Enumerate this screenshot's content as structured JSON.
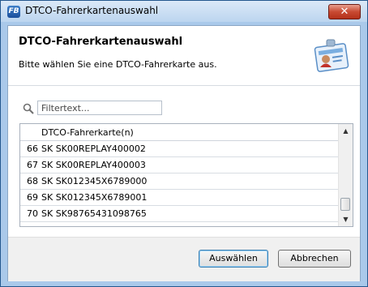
{
  "window": {
    "title": "DTCO-Fahrerkartenauswahl",
    "close_glyph": "✕",
    "app_icon_text": "FB"
  },
  "header": {
    "title": "DTCO-Fahrerkartenauswahl",
    "subtitle": "Bitte wählen Sie eine DTCO-Fahrerkarte aus.",
    "icon": "driver-card-icon"
  },
  "filter": {
    "placeholder": "Filtertext...",
    "value": "",
    "icon": "magnifier-icon"
  },
  "list": {
    "column_header": "DTCO-Fahrerkarte(n)",
    "rows": [
      {
        "num": "66",
        "value": "SK SK00REPLAY400002"
      },
      {
        "num": "67",
        "value": "SK SK00REPLAY400003"
      },
      {
        "num": "68",
        "value": "SK SK012345X6789000"
      },
      {
        "num": "69",
        "value": "SK SK012345X6789001"
      },
      {
        "num": "70",
        "value": "SK SK98765431098765"
      }
    ],
    "scroll_up": "▲",
    "scroll_down": "▼"
  },
  "buttons": {
    "ok": "Auswählen",
    "cancel": "Abbrechen"
  },
  "colors": {
    "accent": "#3c7fb1",
    "titlebar": "#bcd5ef",
    "close": "#c84a32"
  }
}
